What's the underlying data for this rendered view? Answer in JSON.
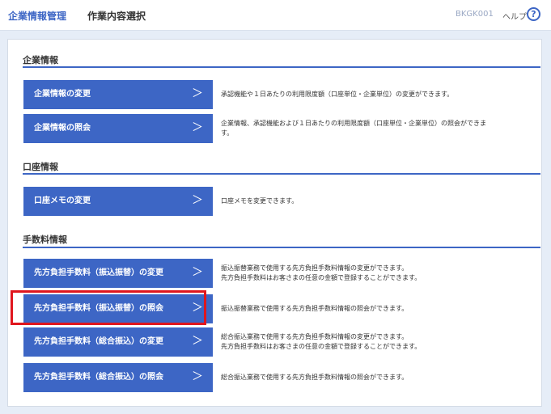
{
  "header": {
    "app_name": "企業情報管理",
    "page_title": "作業内容選択",
    "screen_code": "BKGK001",
    "help_label": "ヘルプ",
    "help_icon": "?"
  },
  "sections": [
    {
      "title": "企業情報",
      "items": [
        {
          "label": "企業情報の変更",
          "desc": [
            "承認機能や１日あたりの利用限度額（口座単位・企業単位）の変更ができます。"
          ]
        },
        {
          "label": "企業情報の照会",
          "desc": [
            "企業情報、承認機能および１日あたりの利用限度額（口座単位・企業単位）の照会ができま",
            "す。"
          ]
        }
      ]
    },
    {
      "title": "口座情報",
      "items": [
        {
          "label": "口座メモの変更",
          "desc": [
            "口座メモを変更できます。"
          ]
        }
      ]
    },
    {
      "title": "手数料情報",
      "items": [
        {
          "label": "先方負担手数料（振込振替）の変更",
          "desc": [
            "振込振替業務で使用する先方負担手数料情報の変更ができます。",
            "先方負担手数料はお客さまの任意の金額で登録することができます。"
          ]
        },
        {
          "label": "先方負担手数料（振込振替）の照会",
          "desc": [
            "振込振替業務で使用する先方負担手数料情報の照会ができます。"
          ]
        },
        {
          "label": "先方負担手数料（総合振込）の変更",
          "desc": [
            "総合振込業務で使用する先方負担手数料情報の変更ができます。",
            "先方負担手数料はお客さまの任意の金額で登録することができます。"
          ]
        },
        {
          "label": "先方負担手数料（総合振込）の照会",
          "desc": [
            "総合振込業務で使用する先方負担手数料情報の照会ができます。"
          ]
        }
      ]
    }
  ],
  "chevron": "＞",
  "highlight_color": "#e0161e",
  "accent_color": "#3d66c5"
}
